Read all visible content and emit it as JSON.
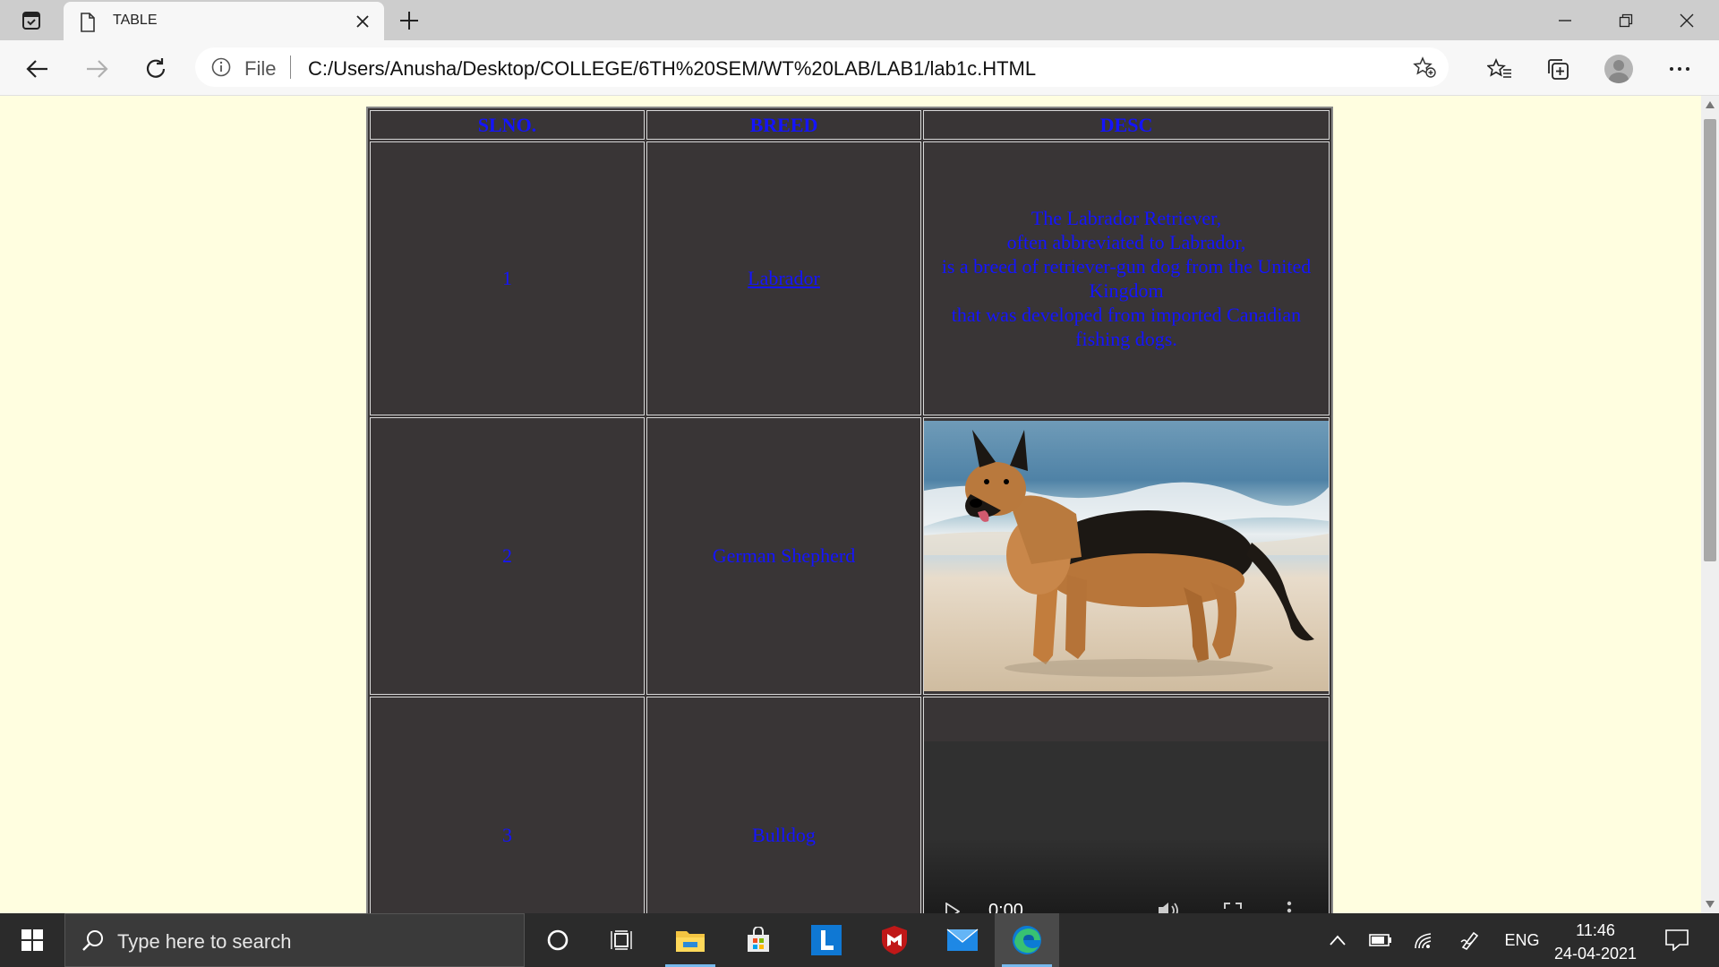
{
  "browser": {
    "tab_title": "TABLE",
    "address_prefix": "File",
    "url": "C:/Users/Anusha/Desktop/COLLEGE/6TH%20SEM/WT%20LAB/LAB1/lab1c.HTML"
  },
  "table": {
    "headers": [
      "SLNO.",
      "BREED",
      "DESC"
    ],
    "rows": [
      {
        "slno": "1",
        "breed": "Labrador",
        "desc_lines": [
          "The Labrador Retriever,",
          "often abbreviated to Labrador,",
          "is a breed of retriever-gun dog from the United Kingdom",
          "that was developed from imported Canadian fishing dogs."
        ]
      },
      {
        "slno": "2",
        "breed": "German Shepherd",
        "desc_media": "german-shepherd-photo"
      },
      {
        "slno": "3",
        "breed": "Bulldog",
        "desc_media": "video-player"
      }
    ]
  },
  "video": {
    "time": "0:00"
  },
  "taskbar": {
    "search_placeholder": "Type here to search",
    "language": "ENG",
    "time": "11:46",
    "date": "24-04-2021"
  },
  "colors": {
    "page_bg": "#fffee0",
    "table_bg": "#393536",
    "text": "#1414ff"
  }
}
